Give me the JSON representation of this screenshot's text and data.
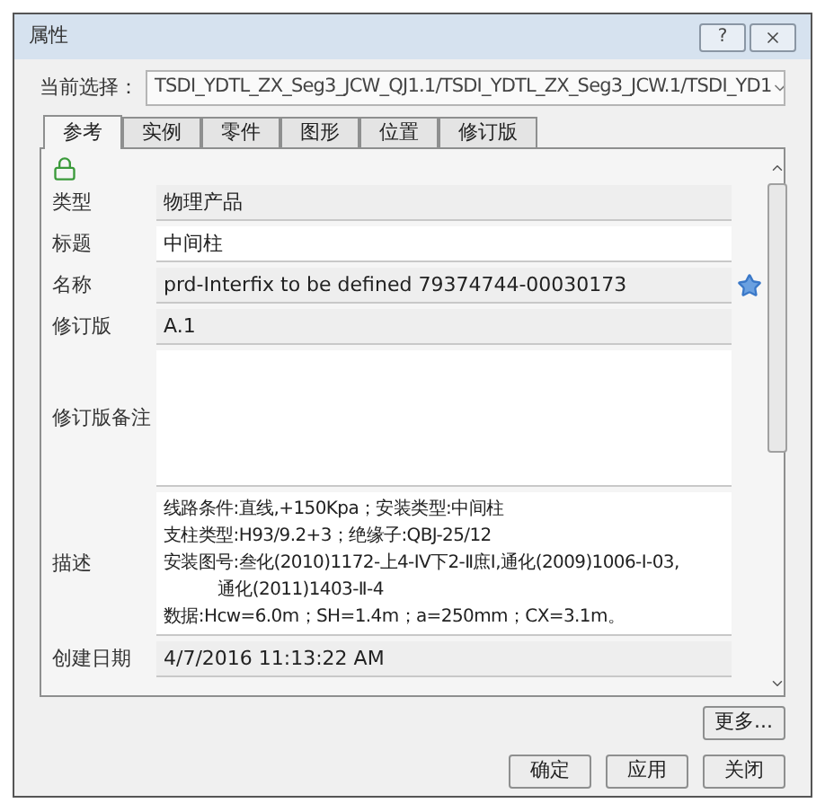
{
  "window": {
    "title": "属性"
  },
  "title_buttons": [
    {
      "kind": "help",
      "label": "?"
    },
    {
      "kind": "close"
    }
  ],
  "selection": {
    "label": "当前选择：",
    "value": "TSDI_YDTL_ZX_Seg3_JCW_QJ1.1/TSDI_YDTL_ZX_Seg3_JCW.1/TSDI_YD1"
  },
  "tabs": [
    {
      "label": "参考",
      "selected": true
    },
    {
      "label": "实例",
      "selected": false
    },
    {
      "label": "零件",
      "selected": false
    },
    {
      "label": "图形",
      "selected": false
    },
    {
      "label": "位置",
      "selected": false
    },
    {
      "label": "修订版",
      "selected": false
    }
  ],
  "fields": [
    {
      "label": "类型",
      "kind": "line",
      "editable": false,
      "paragraphs": [
        [
          "物理产品"
        ]
      ]
    },
    {
      "label": "标题",
      "kind": "line",
      "editable": true,
      "paragraphs": [
        [
          "中间柱"
        ]
      ]
    },
    {
      "label": "名称",
      "kind": "line",
      "editable": false,
      "starred": true,
      "paragraphs": [
        [
          "prd-Interfix to be defined 79374744-00030173"
        ]
      ]
    },
    {
      "label": "修订版",
      "kind": "line",
      "editable": false,
      "paragraphs": [
        [
          "A.1"
        ]
      ]
    },
    {
      "label": "修订版备注",
      "kind": "area",
      "editable": true
    },
    {
      "label": "描述",
      "kind": "area",
      "editable": true,
      "paragraphs": [
        [
          "线路条件:直线,+150Kpa；安装类型:中间柱"
        ],
        [
          "支柱类型:H93/9.2+3；绝缘子:QBJ-25/12"
        ],
        [
          "安装图号:叁化(2010)1172-上4-IV下2-Ⅱ庶Ⅰ,通化(2009)1006-I-03,",
          "通化(2011)1403-Ⅱ-4"
        ],
        [
          "数据:Hcw=6.0m；SH=1.4m；a=250mm；CX=3.1m。"
        ]
      ]
    },
    {
      "label": "创建日期",
      "kind": "line",
      "editable": false,
      "paragraphs": [
        [
          "4/7/2016 11:13:22 AM"
        ]
      ]
    }
  ],
  "more_button": "更多...",
  "buttons": [
    "确定",
    "应用",
    "关闭"
  ]
}
